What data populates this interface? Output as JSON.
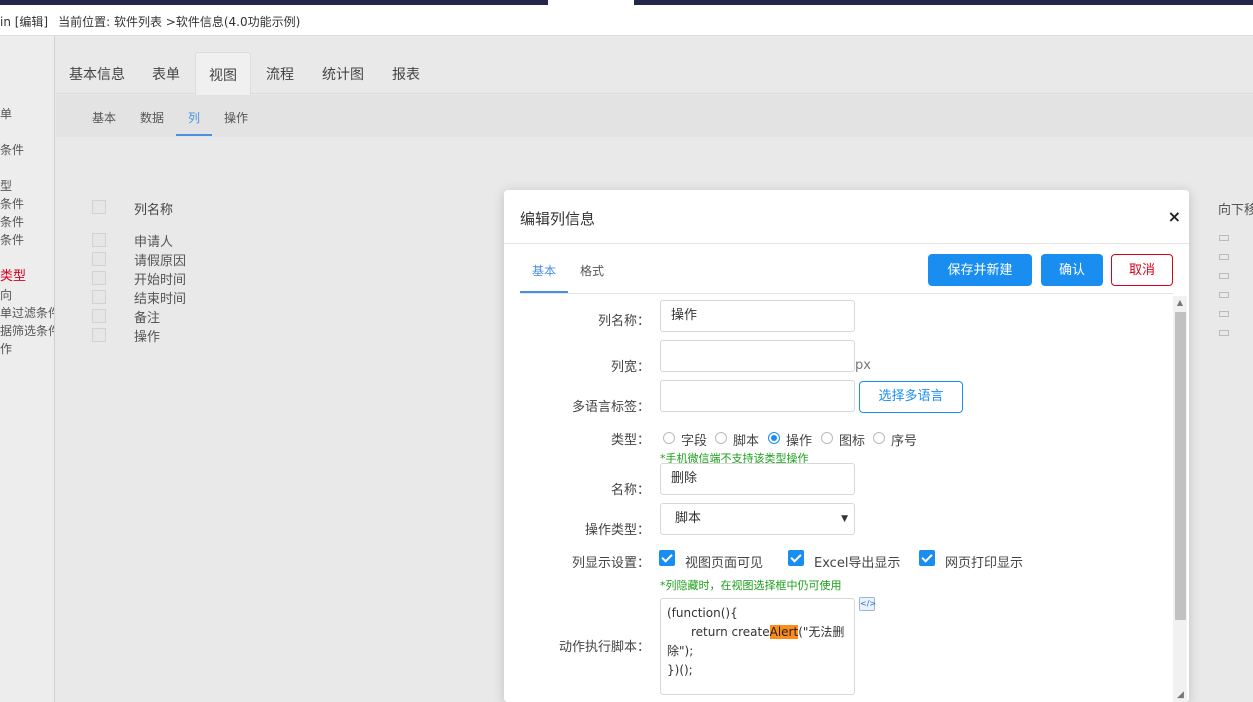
{
  "topbar": {
    "left_text": "in [编辑]",
    "location": "当前位置: 软件列表 >软件信息(4.0功能示例)"
  },
  "leftnav": {
    "items": [
      "单",
      "条件",
      "型",
      "条件",
      "条件",
      "条件",
      "类型",
      "向",
      "单过滤条件",
      "据筛选条件",
      "作"
    ]
  },
  "main_tabs": [
    "基本信息",
    "表单",
    "视图",
    "流程",
    "统计图",
    "报表"
  ],
  "sub_tabs": [
    "基本",
    "数据",
    "列",
    "操作"
  ],
  "grid": {
    "header": "列名称",
    "rows": [
      "申请人",
      "请假原因",
      "开始时间",
      "结束时间",
      "备注",
      "操作"
    ],
    "right_text": "向下移"
  },
  "modal": {
    "title": "编辑列信息",
    "close": "×",
    "tabs": [
      "基本",
      "格式"
    ],
    "buttons": {
      "save_new": "保存并新建",
      "confirm": "确认",
      "cancel": "取消"
    },
    "fields": {
      "col_name": {
        "label": "列名称：",
        "value": "操作"
      },
      "col_width": {
        "label": "列宽：",
        "value": "",
        "unit": "px"
      },
      "multilang": {
        "label": "多语言标签：",
        "value": "",
        "button": "选择多语言"
      },
      "type": {
        "label": "类型：",
        "options": [
          "字段",
          "脚本",
          "操作",
          "图标",
          "序号"
        ],
        "selected": "操作",
        "hint": "*手机微信端不支持该类型操作"
      },
      "name": {
        "label": "名称：",
        "value": "删除"
      },
      "op_type": {
        "label": "操作类型：",
        "value": "脚本"
      },
      "display": {
        "label": "列显示设置：",
        "options": [
          "视图页面可见",
          "Excel导出显示",
          "网页打印显示"
        ],
        "hint": "*列隐藏时，在视图选择框中仍可使用"
      },
      "script": {
        "label": "动作执行脚本：",
        "line1": "(function(){",
        "line2_pre": "return create",
        "line2_hl": "Alert",
        "line2_post": "(\"无法删",
        "line3": "除\");",
        "line4": "})();"
      }
    }
  },
  "colors": {
    "primary": "#1a8ef0",
    "danger": "#d9001b",
    "hint_green": "#1aa01a",
    "highlight": "#ff8c1a"
  }
}
